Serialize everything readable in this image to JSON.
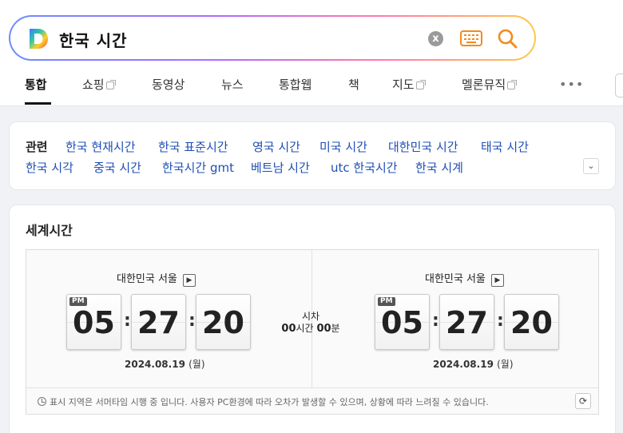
{
  "search": {
    "query": "한국 시간"
  },
  "icons": {
    "clear": "x",
    "keyboard": "keyboard-icon",
    "search": "magnifier-icon",
    "accent": "#f28b1f"
  },
  "tabs": [
    {
      "label": "통합"
    },
    {
      "label": "쇼핑"
    },
    {
      "label": "동영상"
    },
    {
      "label": "뉴스"
    },
    {
      "label": "통합웹"
    },
    {
      "label": "책"
    },
    {
      "label": "지도"
    },
    {
      "label": "멜론뮤직"
    }
  ],
  "more": "•••",
  "related": {
    "label": "관련",
    "links": [
      "한국 현재시간",
      "한국 표준시간",
      "영국 시간",
      "미국 시간",
      "대한민국 시간",
      "태국 시간",
      "한국 시각",
      "중국 시간",
      "한국시간 gmt",
      "베트남 시간",
      "utc 한국시간",
      "한국 시계"
    ],
    "toggle": "⌄"
  },
  "world": {
    "title": "세계시간",
    "left": {
      "city": "대한민국 서울",
      "ampm": "PM",
      "hh": "05",
      "mm": "27",
      "ss": "20",
      "date": "2024.08.19",
      "dow": "(월)"
    },
    "right": {
      "city": "대한민국 서울",
      "ampm": "PM",
      "hh": "05",
      "mm": "27",
      "ss": "20",
      "date": "2024.08.19",
      "dow": "(월)"
    },
    "diff": {
      "label": "시차",
      "hours": "00",
      "hours_unit": "시간",
      "minutes": "00",
      "minutes_unit": "분"
    },
    "city_btn": "▶",
    "colon": ":",
    "notice": "표시 지역은 서머타임 시행 중 입니다. 사용자 PC환경에 따라 오차가 발생할 수 있으며, 상황에 따라 느려질 수 있습니다.",
    "refresh": "⟳"
  }
}
